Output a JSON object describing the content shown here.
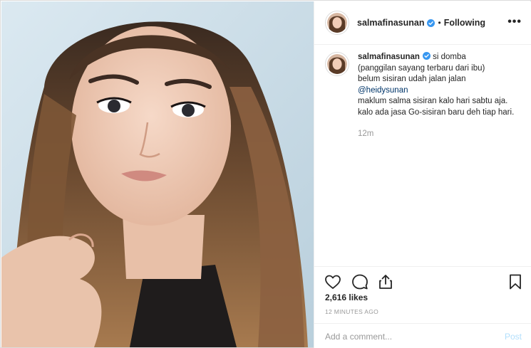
{
  "post": {
    "username": "salmafinasunan",
    "separator": "•",
    "follow_status": "Following",
    "more_label": "•••"
  },
  "caption": {
    "username": "salmafinasunan",
    "line1": " si domba",
    "line2": "(panggilan sayang terbaru dari ibu)",
    "line3": "belum sisiran udah jalan jalan",
    "mention": "@heidysunan",
    "line4": "maklum salma sisiran kalo hari sabtu aja.",
    "line5": "kalo ada jasa Go-sisiran baru deh tiap hari.",
    "relative_time": "12m"
  },
  "stats": {
    "likes": "2,616 likes",
    "timestamp": "12 MINUTES AGO"
  },
  "comment": {
    "placeholder": "Add a comment...",
    "post_label": "Post"
  },
  "icons": {
    "like": "heart-icon",
    "comment": "comment-icon",
    "share": "share-icon",
    "save": "bookmark-icon",
    "verified": "verified-badge-icon"
  },
  "colors": {
    "verified": "#3897f0",
    "link": "#003569",
    "muted": "#999999",
    "post_disabled": "#b2dffc"
  }
}
